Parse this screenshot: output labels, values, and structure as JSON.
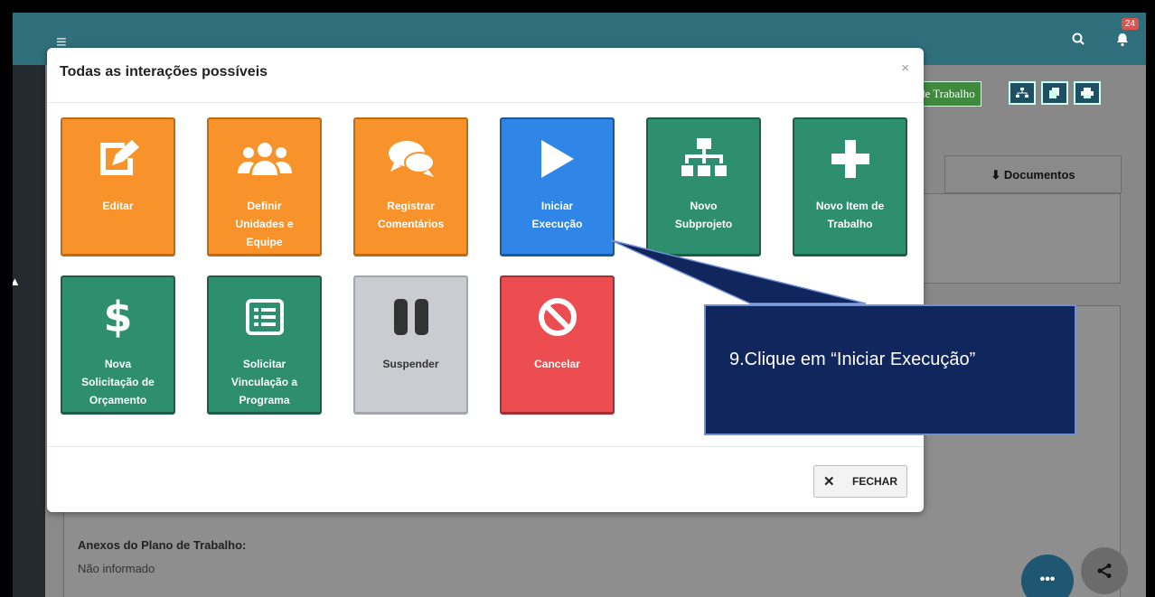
{
  "header": {
    "menu_icon": "menu-icon",
    "search_icon": "search-icon",
    "bell_icon": "bell-icon",
    "notification_count": "24"
  },
  "background": {
    "trabalho_button": "de Trabalho",
    "documentos_tab": "Documentos",
    "annex_label": "Anexos do Plano de Trabalho:",
    "annex_value": "Não informado"
  },
  "modal": {
    "title": "Todas as interações possíveis",
    "close_label": "×",
    "fechar_label": "FECHAR",
    "actions": [
      {
        "label_lines": [
          "Editar"
        ],
        "icon": "edit-icon",
        "color": "#f7932a"
      },
      {
        "label_lines": [
          "Definir",
          "Unidades e",
          "Equipe"
        ],
        "icon": "users-icon",
        "color": "#f7932a"
      },
      {
        "label_lines": [
          "Registrar",
          "Comentários"
        ],
        "icon": "comments-icon",
        "color": "#f7932a"
      },
      {
        "label_lines": [
          "Iniciar",
          "Execução"
        ],
        "icon": "play-icon",
        "color": "#2f86e6"
      },
      {
        "label_lines": [
          "Novo",
          "Subprojeto"
        ],
        "icon": "sitemap-icon",
        "color": "#2e8f6e"
      },
      {
        "label_lines": [
          "Novo Item de",
          "Trabalho"
        ],
        "icon": "plus-icon",
        "color": "#2e8f6e"
      },
      {
        "label_lines": [
          "Nova",
          "Solicitação de",
          "Orçamento"
        ],
        "icon": "dollar-icon",
        "color": "#2e8f6e"
      },
      {
        "label_lines": [
          "Solicitar",
          "Vinculação a",
          "Programa"
        ],
        "icon": "list-icon",
        "color": "#2e8f6e"
      },
      {
        "label_lines": [
          "Suspender"
        ],
        "icon": "pause-icon",
        "color": "#c9ccd0"
      },
      {
        "label_lines": [
          "Cancelar"
        ],
        "icon": "ban-icon",
        "color": "#eb4d50"
      }
    ]
  },
  "callout": {
    "text": "9.Clique em “Iniciar Execução”"
  }
}
